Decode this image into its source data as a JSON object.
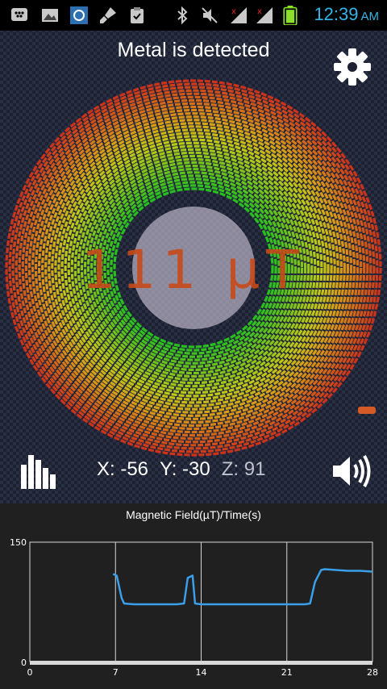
{
  "status_bar": {
    "icons": [
      "bbm-icon",
      "gallery-icon",
      "app-icon",
      "brush-icon",
      "clipboard-icon",
      "bluetooth-icon",
      "mute-icon",
      "signal-icon",
      "signal-icon",
      "battery-icon"
    ],
    "time": "12:39",
    "ampm": "AM",
    "clock_color": "#33b5e5"
  },
  "header": {
    "title": "Metal is detected",
    "settings_icon": "gear-icon"
  },
  "meter": {
    "value": "111 µT",
    "value_color": "#c84a1a"
  },
  "readout": {
    "x": "X: -56",
    "y": "Y: -30",
    "z": "Z: 91"
  },
  "controls": {
    "history_icon": "bar-chart-icon",
    "sound_icon": "speaker-icon"
  },
  "chart_data": {
    "type": "line",
    "title": "Magnetic Field(µT)/Time(s)",
    "xlabel": "",
    "ylabel": "",
    "xlim": [
      0,
      28
    ],
    "ylim": [
      0,
      150
    ],
    "y_ticks": [
      "150",
      "0"
    ],
    "x_ticks": [
      0,
      7,
      14,
      21,
      28
    ],
    "x_tick_labels": [
      "0",
      "7",
      "14",
      "21",
      "28"
    ],
    "grid": true,
    "series": [
      {
        "color": "#3a9fe8",
        "x": [
          6.8,
          7.1,
          7.5,
          7.7,
          8.5,
          10,
          12,
          12.6,
          12.9,
          13.3,
          13.5,
          14,
          16,
          18,
          20,
          22.5,
          22.9,
          23.3,
          23.8,
          24.1,
          25,
          26,
          27,
          28
        ],
        "y": [
          110,
          108,
          80,
          73,
          72,
          72,
          72,
          73,
          105,
          108,
          73,
          72,
          72,
          72,
          72,
          72,
          73,
          100,
          115,
          116,
          115,
          114,
          114,
          113
        ]
      }
    ]
  }
}
